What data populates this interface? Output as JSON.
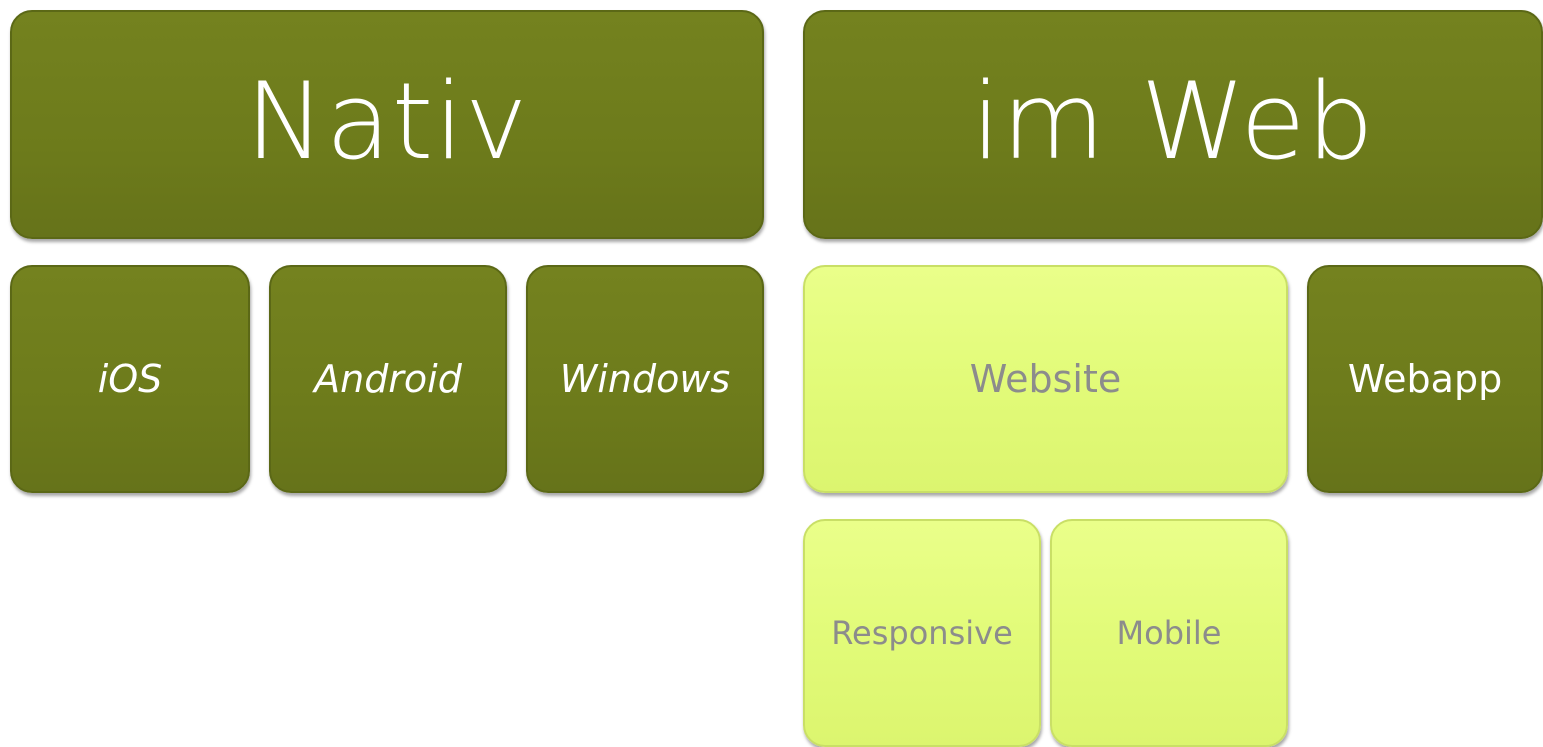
{
  "colors": {
    "dark_tile": "#6f7d1c",
    "light_tile": "#e2fb79",
    "dark_text": "#ffffff",
    "light_text": "#8c8c8c"
  },
  "native": {
    "title": "Nativ",
    "platforms": [
      "iOS",
      "Android",
      "Windows"
    ]
  },
  "web": {
    "title": "im Web",
    "website": {
      "label": "Website",
      "variants": [
        "Responsive",
        "Mobile"
      ]
    },
    "webapp": "Webapp"
  }
}
